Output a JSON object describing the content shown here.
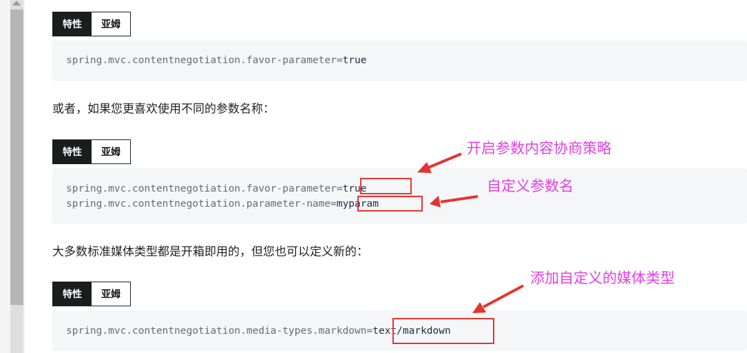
{
  "tabs": {
    "active_label": "特性",
    "inactive_label": "亚姆"
  },
  "block1": {
    "key": "spring.mvc.contentnegotiation.favor-parameter",
    "eq": "=",
    "value": "true"
  },
  "para1": "或者，如果您更喜欢使用不同的参数名称：",
  "block2": {
    "line1_key": "spring.mvc.contentnegotiation.favor-parameter",
    "line1_eq": "=",
    "line1_value": "true",
    "line2_key": "spring.mvc.contentnegotiation.parameter-name",
    "line2_eq": "=",
    "line2_value": "myparam"
  },
  "para2": "大多数标准媒体类型都是开箱即用的，但您也可以定义新的：",
  "block3": {
    "key": "spring.mvc.contentnegotiation.media-types.markdown",
    "eq": "=",
    "value": "text/markdown"
  },
  "annotations": {
    "enable_strategy": "开启参数内容协商策略",
    "custom_param_name": "自定义参数名",
    "add_media_type": "添加自定义的媒体类型"
  },
  "colors": {
    "annotation": "#e63fe3",
    "highlight_box": "#e8322e",
    "arrow": "#e8322e",
    "tab_active": "#1a1c1e"
  }
}
